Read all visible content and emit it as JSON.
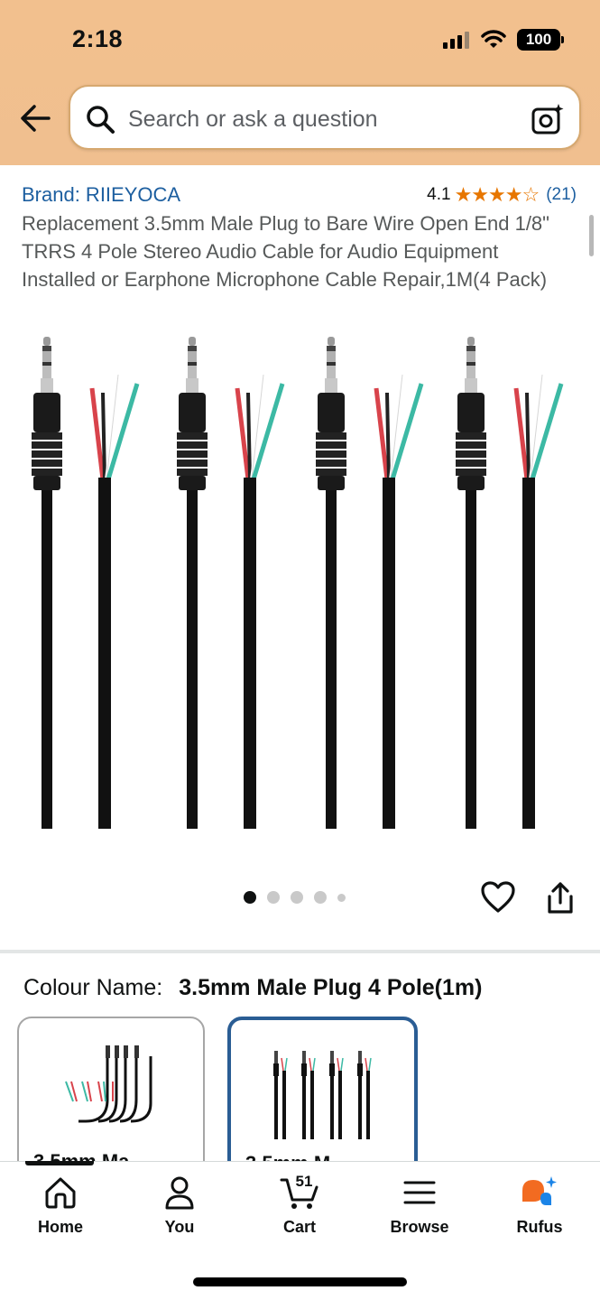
{
  "status_bar": {
    "time": "2:18",
    "battery": "100"
  },
  "search": {
    "placeholder": "Search or ask a question"
  },
  "product": {
    "brand": "Brand: RIIEYOCA",
    "rating": "4.1",
    "stars": "★★★★☆",
    "rating_count": "(21)",
    "title": "Replacement 3.5mm Male Plug to Bare Wire Open End 1/8\" TRRS 4 Pole Stereo Audio Cable for Audio Equipment Installed or Earphone Microphone Cable Repair,1M(4 Pack)"
  },
  "gallery": {
    "count": 5,
    "active_index": 0
  },
  "variants": {
    "label": "Colour Name:",
    "selected_value": "3.5mm Male Plug 4 Pole(1m)",
    "options": [
      {
        "label": "3.5mm Ma",
        "selected": false
      },
      {
        "label": "3.5mm M",
        "selected": true
      }
    ]
  },
  "tabbar": {
    "tabs": [
      {
        "label": "Home",
        "icon": "home-icon"
      },
      {
        "label": "You",
        "icon": "person-icon"
      },
      {
        "label": "Cart",
        "icon": "cart-icon",
        "badge": "51"
      },
      {
        "label": "Browse",
        "icon": "menu-icon"
      },
      {
        "label": "Rufus",
        "icon": "rufus-icon"
      }
    ]
  },
  "colors": {
    "header": "#f2c08e",
    "link": "#1d5fa0",
    "star": "#e77600",
    "selected_border": "#2a5d94"
  }
}
